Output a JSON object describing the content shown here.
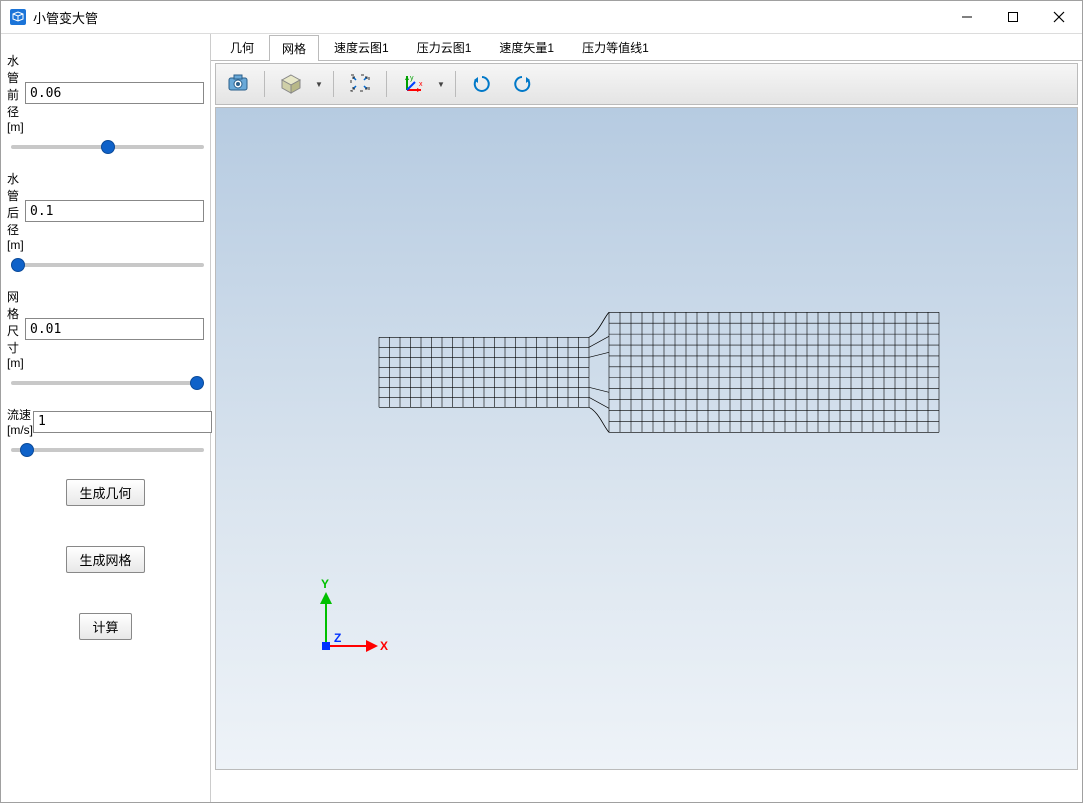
{
  "window": {
    "title": "小管变大管"
  },
  "sidebar": {
    "params": [
      {
        "label": "水管前径[m]",
        "value": "0.06",
        "slider": 50
      },
      {
        "label": "水管后径[m]",
        "value": "0.1",
        "slider": 0
      },
      {
        "label": "网格尺寸[m]",
        "value": "0.01",
        "slider": 100
      },
      {
        "label": "流速[m/s]",
        "value": "1",
        "slider": 5
      }
    ],
    "buttons": {
      "gen_geometry": "生成几何",
      "gen_mesh": "生成网格",
      "compute": "计算"
    }
  },
  "tabs": [
    {
      "label": "几何"
    },
    {
      "label": "网格",
      "active": true
    },
    {
      "label": "速度云图1"
    },
    {
      "label": "压力云图1"
    },
    {
      "label": "速度矢量1"
    },
    {
      "label": "压力等值线1"
    }
  ],
  "toolbar": {
    "items": [
      {
        "name": "camera-icon"
      },
      {
        "name": "isometric-cube-icon",
        "dropdown": true
      },
      {
        "name": "fit-view-icon"
      },
      {
        "name": "axes-icon",
        "dropdown": true
      },
      {
        "name": "rotate-cw-icon"
      },
      {
        "name": "rotate-ccw-icon"
      }
    ]
  },
  "axes": {
    "x": "X",
    "y": "Y",
    "z": "Z"
  },
  "colors": {
    "accent": "#0f62c9",
    "axis_x": "#ff0000",
    "axis_y": "#00c000",
    "axis_z": "#0030ff"
  }
}
